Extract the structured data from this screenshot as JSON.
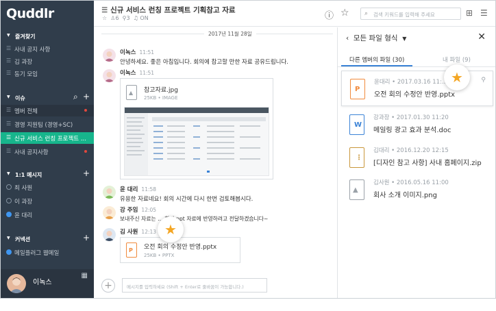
{
  "sidebar": {
    "logo": "Quddlr",
    "sections": {
      "favorites": "즐겨찾기",
      "issues": "이슈",
      "dm": "1:1 메시지",
      "connect": "커넥션"
    },
    "favorites": [
      "사내 공지 사항",
      "김 과장",
      "동기 모임"
    ],
    "issues": [
      "멤버 전체",
      "경영 지원팀 (경영+SC)",
      "신규 서비스 런칭 프로젝트 ...",
      "사내 공지사항"
    ],
    "dm": [
      "최 사원",
      "이 과장",
      "윤 대리"
    ],
    "connect": [
      "메일플러그 웹메일"
    ],
    "me": "이녹스"
  },
  "header": {
    "title": "신규 서비스 런칭 프로젝트 기획참고 자료",
    "members": "6",
    "pins": "3",
    "notify": "ON",
    "search_placeholder": "검색 키워드를 입력해 주세요"
  },
  "chat": {
    "date": "2017년 11월 28일",
    "messages": [
      {
        "name": "이녹스",
        "time": "11:51",
        "text": "안녕하세요. 좋은 아침입니다. 회의에 참고할 만한 자료 공유드립니다."
      },
      {
        "name": "이녹스",
        "time": "11:51",
        "file": "참고자료.jpg",
        "size": "25KB",
        "type": "IMAGE"
      },
      {
        "name": "윤 대리",
        "time": "11:58",
        "text": "유용한 자료네요! 회의 시간에 다시 한번 검토해봅시다."
      },
      {
        "name": "강 주임",
        "time": "12:05",
        "text": "보내주신 자료는 ... 회의 ppt 자료에 반영하려고 전달하겠습니다~"
      },
      {
        "name": "김 사원",
        "time": "12:13",
        "file": "오전 회의 수정안 반영.pptx",
        "size": "25KB",
        "type": "PPTX"
      }
    ],
    "composer_placeholder": "메시지를 입력하세요 (Shift + Enter로 줄바꿈이 가능합니다.)"
  },
  "panel": {
    "title": "모든 파일 형식",
    "tabs": [
      "다른 멤버의 파일 (30)",
      "내 파일 (9)"
    ],
    "files": [
      {
        "uploader": "윤대리",
        "date": "2017.03.16 11:...",
        "name": "오전 회의 수정안 반영.pptx",
        "icon": "pptx-icon"
      },
      {
        "uploader": "강과장",
        "date": "2017.01.30 11:20",
        "name": "메일링 광고 효과 분석.doc",
        "icon": "doc-icon"
      },
      {
        "uploader": "김대리",
        "date": "2016.12.20 12:15",
        "name": "[디자인 참고 사항] 사내 홈페이지.zip",
        "icon": "zip-icon"
      },
      {
        "uploader": "김사원",
        "date": "2016.05.16 11:00",
        "name": "회사 소개 이미지.png",
        "icon": "image-icon"
      }
    ]
  },
  "colors": {
    "sidebar": "#303d4b",
    "highlight": "#17b58c",
    "accent": "#3a82d6",
    "star": "#f4a624"
  }
}
